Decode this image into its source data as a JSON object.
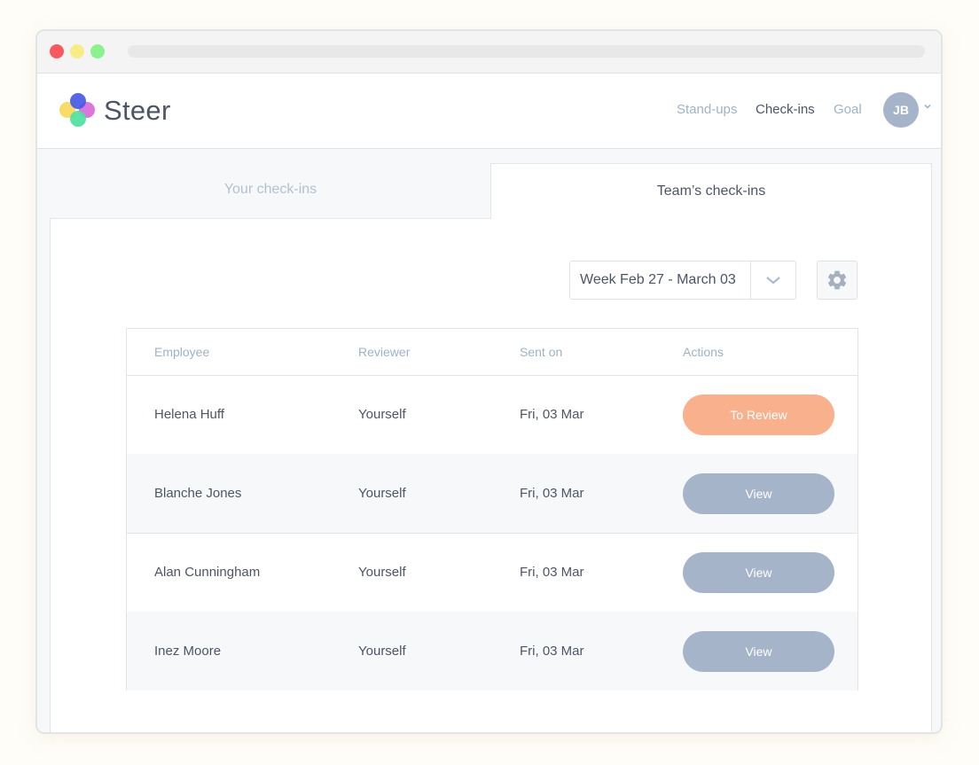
{
  "app": {
    "brand": "Steer"
  },
  "nav": {
    "items": [
      "Stand-ups",
      "Check-ins",
      "Goal"
    ],
    "active": "Check-ins"
  },
  "user": {
    "initials": "JB"
  },
  "tabs": {
    "inactive": "Your check-ins",
    "active": "Team’s check-ins"
  },
  "filter": {
    "week": "Week Feb 27 - March 03"
  },
  "table": {
    "headers": [
      "Employee",
      "Reviewer",
      "Sent on",
      "Actions"
    ],
    "rows": [
      {
        "employee": "Helena Huff",
        "reviewer": "Yourself",
        "sent_on": "Fri, 03 Mar",
        "action": "To Review"
      },
      {
        "employee": "Blanche Jones",
        "reviewer": "Yourself",
        "sent_on": "Fri, 03 Mar",
        "action": "View"
      },
      {
        "employee": "Alan Cunningham",
        "reviewer": "Yourself",
        "sent_on": "Fri, 03 Mar",
        "action": "View"
      },
      {
        "employee": "Inez Moore",
        "reviewer": "Yourself",
        "sent_on": "Fri, 03 Mar",
        "action": "View"
      }
    ]
  },
  "colors": {
    "accent_review": "#f9b08d",
    "button_view": "#a5b4c9",
    "text_primary": "#4d5565",
    "text_muted": "#9fb2c7"
  }
}
